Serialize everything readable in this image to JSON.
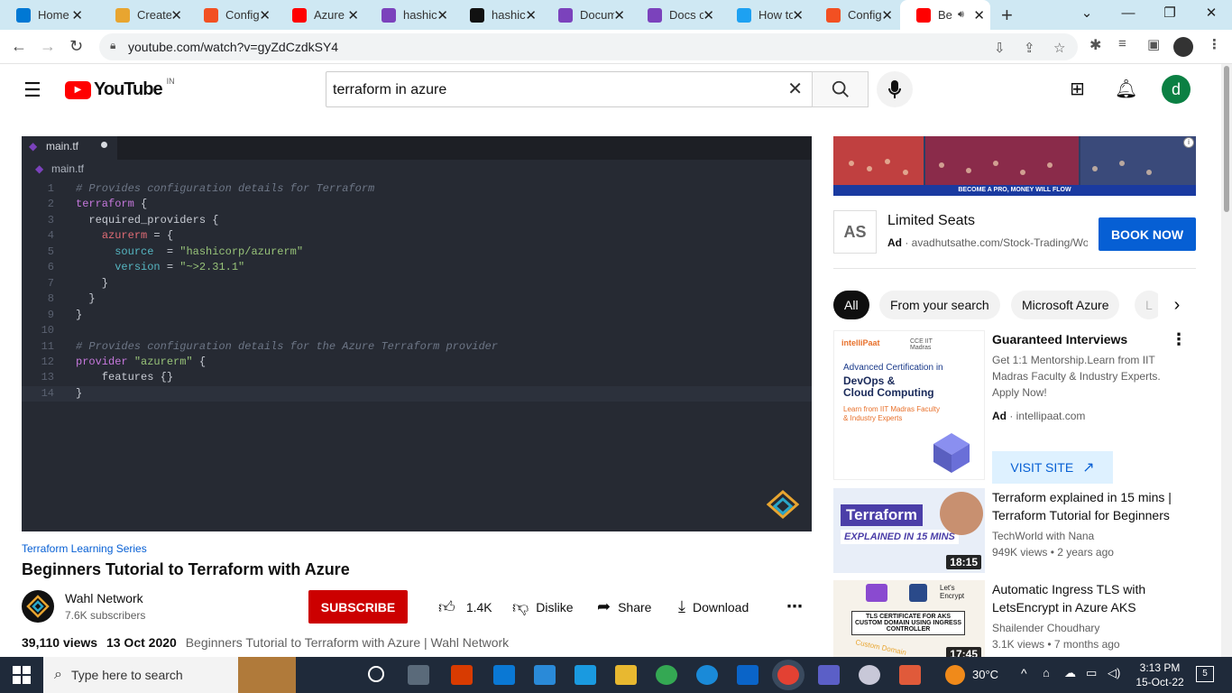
{
  "browser": {
    "tabs": [
      {
        "label": "Home",
        "icon": "azure-icon",
        "color": "#0078d4"
      },
      {
        "label": "Create",
        "icon": "create-icon",
        "color": "#e8a530"
      },
      {
        "label": "Config",
        "icon": "microsoft-icon",
        "color": "#f25022"
      },
      {
        "label": "Azure",
        "icon": "youtube-icon",
        "color": "#ff0000"
      },
      {
        "label": "hashic",
        "icon": "terraform-icon",
        "color": "#7b42bc"
      },
      {
        "label": "hashic",
        "icon": "github-icon",
        "color": "#111111"
      },
      {
        "label": "Docum",
        "icon": "terraform-icon",
        "color": "#7b42bc"
      },
      {
        "label": "Docs o",
        "icon": "terraform-icon",
        "color": "#7b42bc"
      },
      {
        "label": "How to",
        "icon": "edge-icon",
        "color": "#1da1f2"
      },
      {
        "label": "Config",
        "icon": "microsoft-icon",
        "color": "#f25022"
      },
      {
        "label": "Be",
        "icon": "youtube-icon",
        "color": "#ff0000",
        "active": true
      }
    ],
    "url": "youtube.com/watch?v=gyZdCzdkSY4"
  },
  "youtube": {
    "logo_text": "YouTube",
    "logo_region": "IN",
    "search_value": "terraform in azure",
    "avatar_letter": "d"
  },
  "video": {
    "editor_tab": "main.tf",
    "breadcrumb": "main.tf",
    "code_lines": [
      {
        "n": "1",
        "html": "<span class='cm'># Provides configuration details for Terraform</span>"
      },
      {
        "n": "2",
        "html": "<span class='kw'>terraform</span><span class='pl'> {</span>"
      },
      {
        "n": "3",
        "html": "<span class='pl'>  required_providers {</span>"
      },
      {
        "n": "4",
        "html": "<span class='pl'>    </span><span class='id'>azurerm</span><span class='pl'> = {</span>"
      },
      {
        "n": "5",
        "html": "<span class='pl'>      </span><span class='at'>source</span><span class='pl'>  = </span><span class='st'>\"hashicorp/azurerm\"</span>"
      },
      {
        "n": "6",
        "html": "<span class='pl'>      </span><span class='at'>version</span><span class='pl'> = </span><span class='st'>\"~>2.31.1\"</span>"
      },
      {
        "n": "7",
        "html": "<span class='pl'>    }</span>"
      },
      {
        "n": "8",
        "html": "<span class='pl'>  }</span>"
      },
      {
        "n": "9",
        "html": "<span class='pl'>}</span>"
      },
      {
        "n": "10",
        "html": ""
      },
      {
        "n": "11",
        "html": "<span class='cm'># Provides configuration details for the Azure Terraform provider</span>"
      },
      {
        "n": "12",
        "html": "<span class='kw'>provider</span><span class='pl'> </span><span class='st'>\"azurerm\"</span><span class='pl'> {</span>"
      },
      {
        "n": "13",
        "html": "<span class='pl'>    features {}</span>"
      },
      {
        "n": "14",
        "html": "<span class='pl'>}</span>"
      }
    ],
    "series_link": "Terraform Learning Series",
    "title": "Beginners Tutorial to Terraform with Azure",
    "channel": "Wahl Network",
    "subscribers": "7.6K subscribers",
    "subscribe_label": "SUBSCRIBE",
    "likes": "1.4K",
    "dislike_label": "Dislike",
    "share_label": "Share",
    "download_label": "Download",
    "views": "39,110 views",
    "date": "13 Oct 2020",
    "description": "Beginners Tutorial to Terraform with Azure | Wahl Network"
  },
  "sidebar": {
    "banner_strip": "BECOME A PRO, MONEY WILL FLOW",
    "ad_logo": "AS",
    "ad_title": "Limited Seats",
    "ad_badge": "Ad",
    "ad_domain": "avadhutsathe.com/Stock-Trading/Workshop",
    "book_now": "BOOK NOW",
    "chips": [
      "All",
      "From your search",
      "Microsoft Azure",
      "L"
    ],
    "recs": [
      {
        "title": "Guaranteed Interviews",
        "desc": "Get 1:1 Mentorship.Learn from IIT Madras Faculty & Industry Experts. Apply Now!",
        "ad_badge": "Ad",
        "domain": "intellipaat.com",
        "cta": "VISIT SITE",
        "thumb_brand": "intelliPaat",
        "thumb_partner": "CCE IIT Madras",
        "thumb_line1": "Advanced Certification in",
        "thumb_line2": "DevOps &",
        "thumb_line3": "Cloud Computing",
        "thumb_line4": "Learn from IIT Madras Faculty",
        "thumb_line5": "& Industry Experts"
      },
      {
        "title": "Terraform explained in 15 mins | Terraform Tutorial for Beginners",
        "channel": "TechWorld with Nana",
        "stats": "949K views • 2 years ago",
        "duration": "18:15",
        "thumb_text1": "Terraform",
        "thumb_text2": "EXPLAINED IN 15 MINS"
      },
      {
        "title": "Automatic Ingress TLS with LetsEncrypt in Azure AKS",
        "channel": "Shailender Choudhary",
        "stats": "3.1K views • 7 months ago",
        "duration": "17:45",
        "thumb_text1": "TLS CERTIFICATE FOR AKS CUSTOM DOMAIN USING INGRESS CONTROLLER",
        "thumb_text2": "Custom Domain",
        "thumb_text3": "Let's Encrypt"
      }
    ]
  },
  "taskbar": {
    "search_placeholder": "Type here to search",
    "weather": "30°C",
    "time": "3:13 PM",
    "date": "15-Oct-22",
    "notification_count": "5"
  }
}
